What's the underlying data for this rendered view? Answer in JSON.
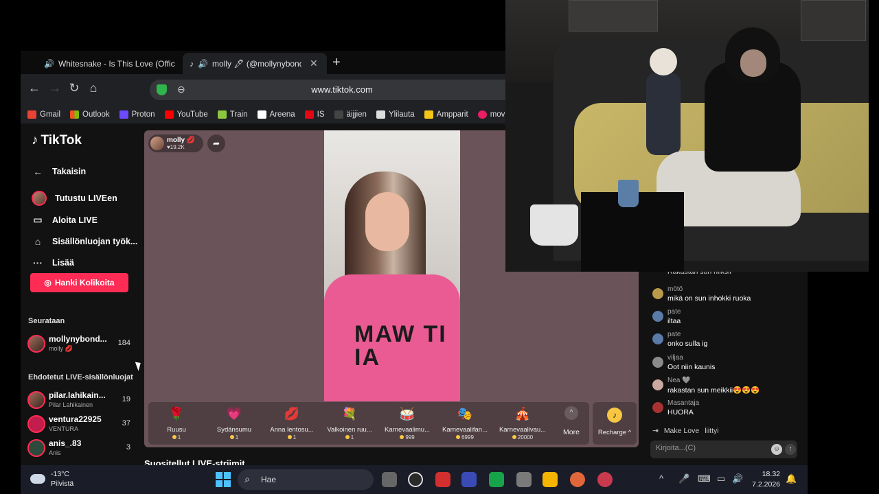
{
  "browser": {
    "tabs": [
      {
        "label": "Whitesnake - Is This Love (Offic",
        "icon": "youtube-icon"
      },
      {
        "label": "molly 🖋 (@mollynybonde",
        "icon": "tiktok-icon"
      }
    ],
    "url": "www.tiktok.com",
    "bookmarks": [
      "Gmail",
      "Outlook",
      "Proton",
      "YouTube",
      "Train",
      "Areena",
      "IS",
      "äijjien",
      "Ylilauta",
      "Ampparit",
      "movies"
    ]
  },
  "sidebar": {
    "logo": "TikTok",
    "back_label": "Takaisin",
    "items": [
      "Tutustu LIVEen",
      "Aloita LIVE",
      "Sisällönluojan työk...",
      "Lisää"
    ],
    "coins_button": "Hanki Kolikoita",
    "following_title": "Seurataan",
    "following": [
      {
        "name": "mollynybond...",
        "sub": "molly 💋",
        "count": "184"
      }
    ],
    "suggested_title": "Ehdotetut LIVE-sisällönluojat",
    "suggested": [
      {
        "name": "pilar.lahikain...",
        "sub": "Pilar Lahikainen",
        "count": "19"
      },
      {
        "name": "ventura22925",
        "sub": "VENTURA",
        "count": "37"
      },
      {
        "name": "anis_.83",
        "sub": "Anis",
        "count": "3"
      }
    ]
  },
  "live": {
    "host_name": "molly 💋",
    "host_likes": "♥19.2K",
    "shirt_text": "MAW TI IA",
    "gifts": [
      {
        "name": "Ruusu",
        "cost": "1",
        "icon": "🌹"
      },
      {
        "name": "Sydänsumu",
        "cost": "1",
        "icon": "💗"
      },
      {
        "name": "Anna lentosu...",
        "cost": "1",
        "icon": "💋"
      },
      {
        "name": "Valkoinen ruu...",
        "cost": "1",
        "icon": "💐"
      },
      {
        "name": "Karnevaalimu...",
        "cost": "999",
        "icon": "🥁"
      },
      {
        "name": "Karnevaalifan...",
        "cost": "6999",
        "icon": "🎭"
      },
      {
        "name": "Karnevaalivau...",
        "cost": "20000",
        "icon": "🎪"
      }
    ],
    "more_label": "More",
    "recharge_label": "Recharge ^",
    "suggested_streams": "Suositellut LIVE-striimit"
  },
  "chat": {
    "partial_top": "Rakastan sun niiksii",
    "messages": [
      {
        "user": "mötö",
        "text": "mikä on sun inhokki ruoka",
        "color": "#b99a4a"
      },
      {
        "user": "pate",
        "text": "iltaa",
        "color": "#5a7aa8"
      },
      {
        "user": "pate",
        "text": "onko sulla ig",
        "color": "#5a7aa8"
      },
      {
        "user": "viljaa",
        "text": "Oot niin kaunis",
        "color": "#8a8a8a"
      },
      {
        "user": "Nea 🩶",
        "text": "rakastan sun meikkii😍😍😍",
        "color": "#c9a9a0"
      },
      {
        "user": "Masantaja",
        "text": "HUORA",
        "color": "#a83232"
      }
    ],
    "join_user": "Make Love",
    "join_text": "liittyi",
    "input_placeholder": "Kirjoita...(C)"
  },
  "taskbar": {
    "temperature": "-13°C",
    "weather": "Pilvistä",
    "search_label": "Hae",
    "time": "18.32",
    "date": "7.2.2026"
  }
}
